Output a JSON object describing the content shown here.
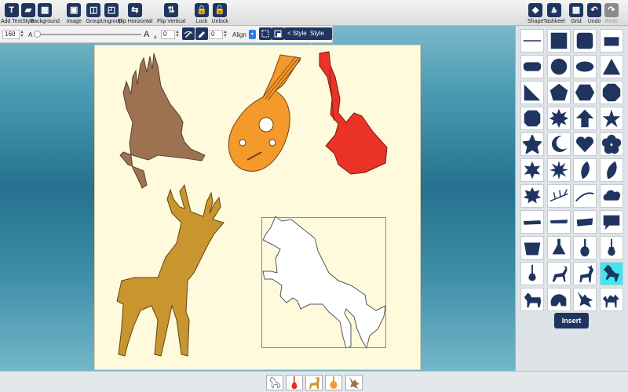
{
  "toolbar": {
    "left": [
      {
        "key": "add-text",
        "label": "Add Text",
        "glyph": "T"
      },
      {
        "key": "style",
        "label": "Style",
        "glyph": "▰"
      },
      {
        "key": "background",
        "label": "Background",
        "glyph": "▦"
      },
      {
        "key": "image",
        "label": "Image",
        "glyph": "▣"
      },
      {
        "key": "group",
        "label": "Group",
        "glyph": "◫"
      },
      {
        "key": "ungroup",
        "label": "Ungroup",
        "glyph": "◰"
      },
      {
        "key": "flip-horizontal",
        "label": "Flip Horizontal",
        "glyph": "⇆"
      },
      {
        "key": "flip-vertical",
        "label": "Flip Vertical",
        "glyph": "⇅"
      },
      {
        "key": "lock",
        "label": "Lock",
        "glyph": "🔒"
      },
      {
        "key": "unlock",
        "label": "Unlock",
        "glyph": "🔓"
      }
    ],
    "right": [
      {
        "key": "shape",
        "label": "Shape",
        "glyph": "◆"
      },
      {
        "key": "tashkeel",
        "label": "Tashkeel",
        "glyph": "ۿ"
      },
      {
        "key": "grid",
        "label": "Grid",
        "glyph": "▦"
      },
      {
        "key": "undo",
        "label": "Undo",
        "glyph": "↶"
      },
      {
        "key": "redo",
        "label": "Redo",
        "glyph": "↷"
      }
    ]
  },
  "subbar": {
    "font_size": "160",
    "small_a": "A",
    "big_a": "A",
    "char_spacing_icon": "a",
    "spacing_value": "0",
    "line_width_value": "0",
    "align_label": "Align",
    "style_prev": "< Style",
    "style_next": "Style >"
  },
  "panel": {
    "insert_label": "Insert",
    "shapes": [
      "line",
      "square",
      "rounded-square",
      "square-small",
      "rounded-rect",
      "circle",
      "ellipse",
      "triangle",
      "right-triangle",
      "pentagon",
      "hexagon",
      "octagon",
      "octagon-2",
      "star-8",
      "arrow-up",
      "star-5",
      "star-5-round",
      "crescent",
      "heart",
      "flower",
      "star-6",
      "star-burst",
      "leaf",
      "leaf-2",
      "maple-leaf",
      "branch",
      "brush-1",
      "cloud",
      "brush-2",
      "brush-3",
      "brush-4",
      "speech-bubble",
      "bowl",
      "flask",
      "lute",
      "guitar",
      "guitar-2",
      "gazelle",
      "deer",
      "horse",
      "horse-2",
      "helmet",
      "eagle",
      "camel"
    ],
    "selected_index": 39
  },
  "canvas": {
    "colors": {
      "eagle": "#9c7250",
      "lute": "#f39a2a",
      "guitar": "#ea3226",
      "deer": "#c9952f",
      "horse": "#ffffff"
    }
  },
  "bottom_thumbs": [
    "horse-thumb",
    "guitar-thumb",
    "deer-thumb",
    "lute-thumb",
    "eagle-thumb"
  ]
}
